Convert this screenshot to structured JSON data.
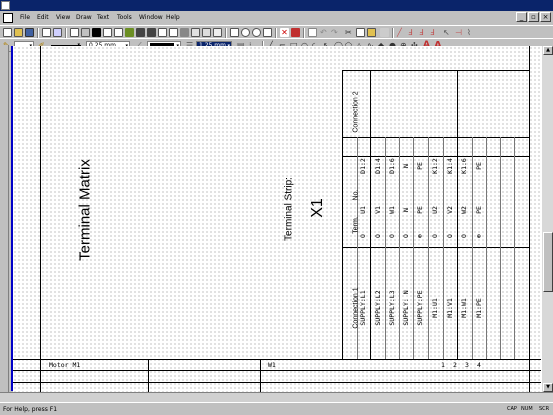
{
  "menu": [
    "File",
    "Edit",
    "View",
    "Draw",
    "Text",
    "Tools",
    "Window",
    "Help"
  ],
  "toolbar2": {
    "line_width": "0.25 mm",
    "pen_width": "1.25 mm",
    "pen_color": "#000000"
  },
  "drawing": {
    "title": "Terminal Matrix",
    "strip_label": "Terminal Strip:",
    "strip_id": "X1",
    "headers": {
      "connection1": "Connection 1",
      "term": "Term.",
      "no": "No.",
      "connection2": "Connection 2"
    },
    "rows": [
      {
        "c1": "SUPPLY:L1",
        "term": "O",
        "no": "U1",
        "c2": "D1:2"
      },
      {
        "c1": "SUPPLY:L2",
        "term": "O",
        "no": "V1",
        "c2": "D1:4"
      },
      {
        "c1": "SUPPLY:L3",
        "term": "O",
        "no": "W1",
        "c2": "D1:6"
      },
      {
        "c1": "SUPPLY: N",
        "term": "O",
        "no": "N",
        "c2": "N"
      },
      {
        "c1": "SUPPLY:PE",
        "term": "⊕",
        "no": "PE",
        "c2": "PE"
      },
      {
        "c1": "M1:U1",
        "term": "O",
        "no": "U2",
        "c2": "K1:2"
      },
      {
        "c1": "M1:V1",
        "term": "O",
        "no": "V2",
        "c2": "K1:4"
      },
      {
        "c1": "M1:W1",
        "term": "O",
        "no": "W2",
        "c2": "K1:6"
      },
      {
        "c1": "M1:PE",
        "term": "⊕",
        "no": "PE",
        "c2": "PE"
      }
    ],
    "bottom_left": "Motor M1",
    "bottom_mid": "W1",
    "bottom_nums": [
      "1",
      "2",
      "3",
      "4"
    ]
  },
  "status": {
    "help": "For Help, press F1",
    "cap": "CAP",
    "num": "NUM",
    "scr": "SCR"
  }
}
